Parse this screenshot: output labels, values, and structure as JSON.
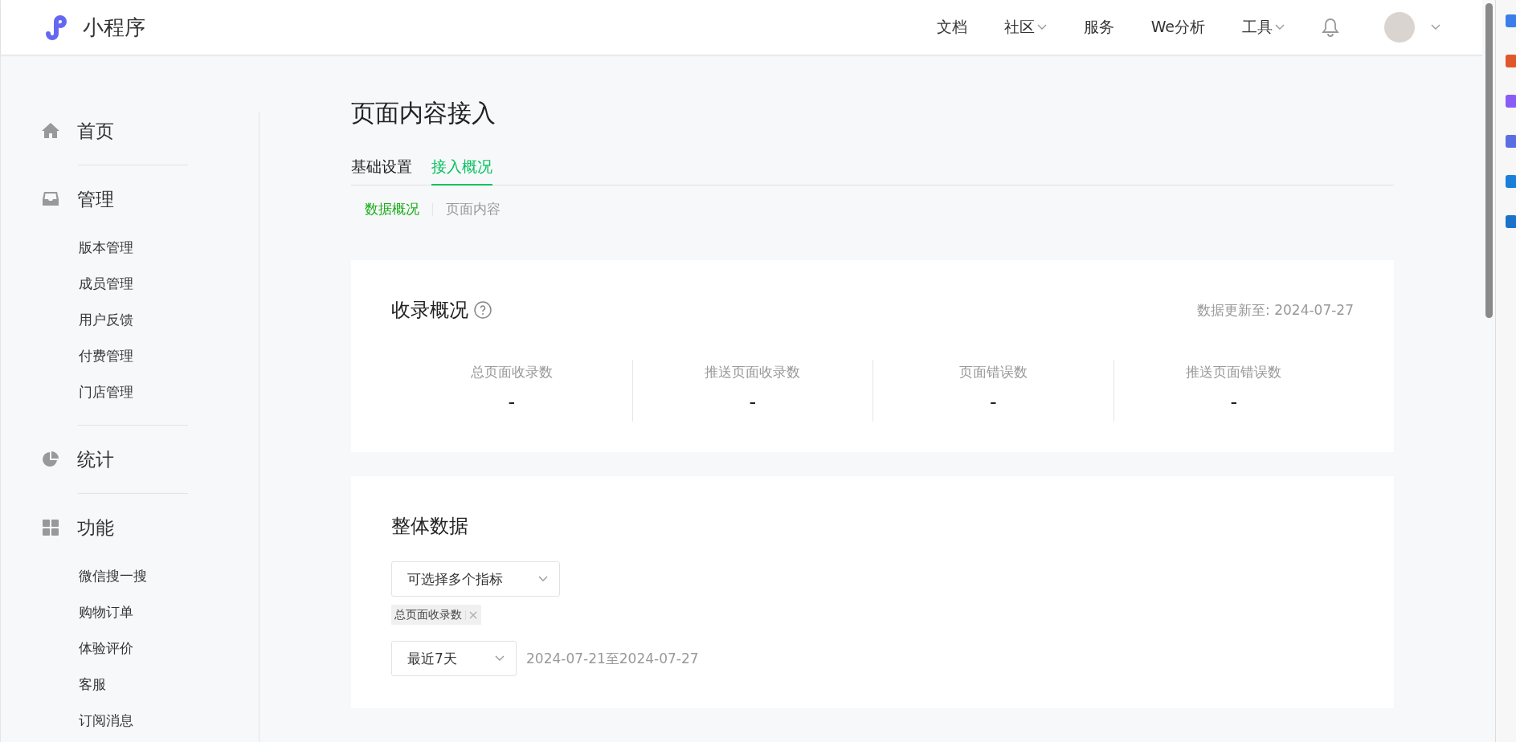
{
  "header": {
    "logo_text": "小程序",
    "nav": [
      {
        "label": "文档",
        "dropdown": false
      },
      {
        "label": "社区",
        "dropdown": true
      },
      {
        "label": "服务",
        "dropdown": false
      },
      {
        "label": "We分析",
        "dropdown": false
      },
      {
        "label": "工具",
        "dropdown": true
      }
    ]
  },
  "sidebar": {
    "sections": [
      {
        "label": "首页"
      },
      {
        "label": "管理",
        "items": [
          "版本管理",
          "成员管理",
          "用户反馈",
          "付费管理",
          "门店管理"
        ]
      },
      {
        "label": "统计"
      },
      {
        "label": "功能",
        "items": [
          "微信搜一搜",
          "购物订单",
          "体验评价",
          "客服",
          "订阅消息"
        ]
      }
    ]
  },
  "page_title": "页面内容接入",
  "tabs": [
    {
      "label": "基础设置",
      "selected": false
    },
    {
      "label": "接入概况",
      "selected": true
    }
  ],
  "subtabs": [
    {
      "label": "数据概况",
      "selected": true
    },
    {
      "label": "页面内容",
      "selected": false
    }
  ],
  "summary_card": {
    "title": "收录概况",
    "updated": "数据更新至: 2024-07-27",
    "stats": [
      {
        "label": "总页面收录数",
        "value": "-"
      },
      {
        "label": "推送页面收录数",
        "value": "-"
      },
      {
        "label": "页面错误数",
        "value": "-"
      },
      {
        "label": "推送页面错误数",
        "value": "-"
      }
    ]
  },
  "overall_card": {
    "title": "整体数据",
    "metric_select": {
      "placeholder": "可选择多个指标"
    },
    "tags": [
      "总页面收录数"
    ],
    "range_select": {
      "value": "最近7天"
    },
    "range_text": "2024-07-21至2024-07-27"
  }
}
